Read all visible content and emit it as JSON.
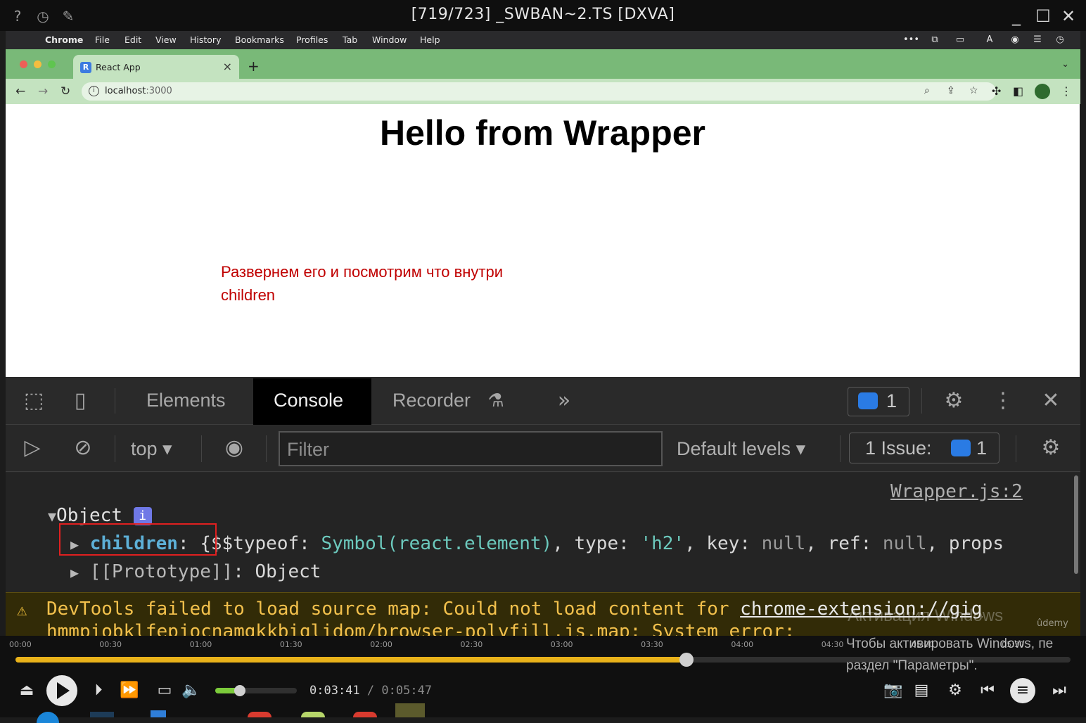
{
  "player_title": "[719/723] _SWBAN~2.TS [DXVA]",
  "mac_menu": [
    "Chrome",
    "File",
    "Edit",
    "View",
    "History",
    "Bookmarks",
    "Profiles",
    "Tab",
    "Window",
    "Help"
  ],
  "browser": {
    "tab_favicon": "R",
    "tab_title": "React App",
    "url_host": "localhost",
    "url_port": ":3000"
  },
  "page": {
    "heading": "Hello from Wrapper",
    "annotation_line1": "Развернем его и посмотрим что внутри",
    "annotation_line2": "children"
  },
  "devtools": {
    "tabs": [
      "Elements",
      "Console",
      "Recorder"
    ],
    "active_tab": "Console",
    "issues_count": "1",
    "context": "top",
    "filter_placeholder": "Filter",
    "levels": "Default levels",
    "issue_label": "1 Issue:",
    "issue_count": "1",
    "console": {
      "source": "Wrapper.js:2",
      "object_label": "Object",
      "info_badge": "i",
      "children_key": "children",
      "children_value": {
        "open": "{",
        "typeof_key": "$$typeof",
        "typeof_val": "Symbol(react.element)",
        "type_key": "type",
        "type_val": "'h2'",
        "key_key": "key",
        "key_val": "null",
        "ref_key": "ref",
        "ref_val": "null",
        "props_key": "props"
      },
      "prototype_key": "[[Prototype]]",
      "prototype_val": "Object"
    },
    "warning_line1": "DevTools failed to load source map: Could not load content for",
    "warning_link": "chrome-extension://gig",
    "warning_line2": "hmmpiobklfepjocnamgkkbiglidom/browser-polyfill.js.map: System error:"
  },
  "watermark": {
    "line1": "Активация Windows",
    "line2": "Чтобы активировать Windows, пе",
    "line3": "раздел \"Параметры\".",
    "udemy": "ûdemy"
  },
  "player": {
    "timeline_labels": [
      "00:00",
      "00:30",
      "01:00",
      "01:30",
      "02:00",
      "02:30",
      "03:00",
      "03:30",
      "04:00",
      "04:30",
      "05:00",
      "05:30"
    ],
    "position": "0:03:41",
    "duration": "0:05:47",
    "progress_fraction": 0.636,
    "volume_fraction": 0.3
  },
  "colors": {
    "tab_strip": "#79b978",
    "annotation": "#c00000",
    "seek": "#e9b21a",
    "volume": "#7ccb3b",
    "badge_blue": "#2a7be4"
  }
}
